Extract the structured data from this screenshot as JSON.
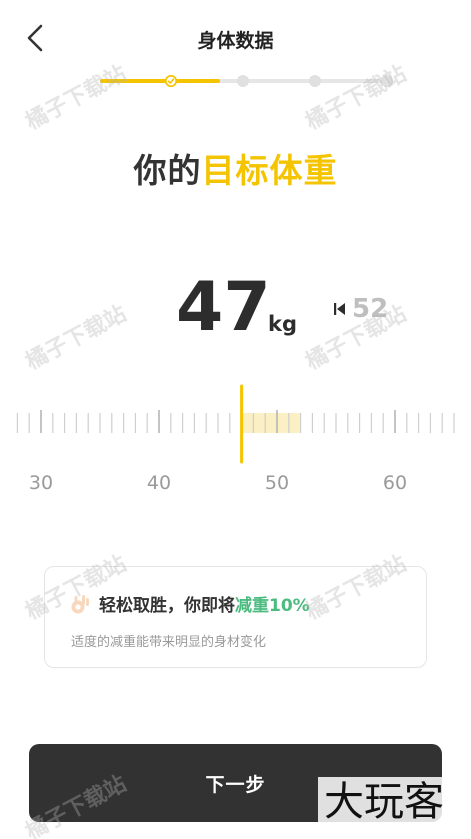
{
  "header": {
    "title": "身体数据",
    "back_icon": "chevron-left-icon"
  },
  "progress": {
    "total_steps": 4,
    "current_step": 1,
    "active_color": "#f5c400",
    "inactive_color": "#e0e0e0"
  },
  "title": {
    "plain": "你的",
    "accent": "目标体重",
    "accent_color": "#f5c400"
  },
  "weight": {
    "value": "47",
    "unit": "kg",
    "start_value": "52",
    "start_icon": "triangle-left-icon"
  },
  "ruler": {
    "min": 28,
    "max": 65,
    "step": 1,
    "selected": 47,
    "start": 52,
    "labels": [
      "30",
      "40",
      "50",
      "60"
    ],
    "label_values": [
      30,
      40,
      50,
      60
    ],
    "highlight_color": "#fbefc4",
    "indicator_color": "#f5c400"
  },
  "tip": {
    "icon": "ok-hand-icon",
    "prefix": "轻松取胜，你即将",
    "highlight": "减重10%",
    "highlight_color": "#4cbb7f",
    "subtitle": "适度的减重能带来明显的身材变化"
  },
  "footer": {
    "next_label": "下一步"
  },
  "watermark": {
    "text": "橘子下载站",
    "logo": "大玩客"
  }
}
